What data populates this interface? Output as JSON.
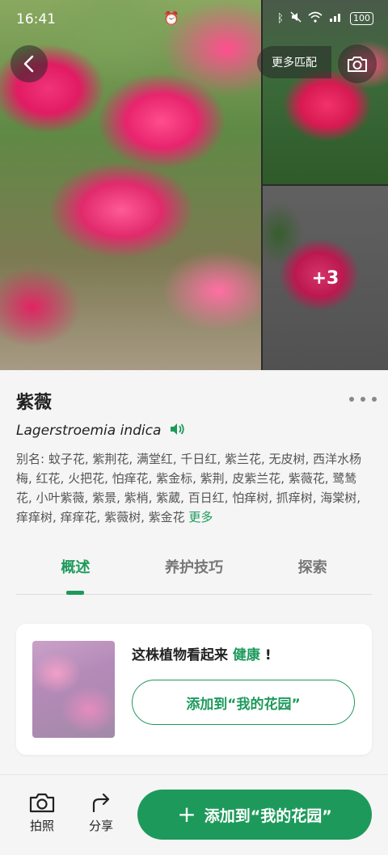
{
  "status": {
    "time": "16:41",
    "battery": "100",
    "icons": [
      "alarm-icon",
      "bluetooth-icon",
      "mute-icon",
      "wifi-icon",
      "signal-icon",
      "battery-icon"
    ]
  },
  "gallery": {
    "more_matches_label": "更多匹配",
    "extra_count": "+3"
  },
  "plant": {
    "name": "紫薇",
    "scientific_name": "Lagerstroemia indica",
    "aliases_text": "别名: 蚊子花, 紫荆花, 满堂红, 千日红, 紫兰花, 无皮树, 西洋水杨梅, 红花, 火把花, 怕痒花, 紫金标, 紫荆, 皮紫兰花, 紫薇花, 鹭鸶花, 小叶紫薇, 紫景, 紫梢, 紫葳, 百日红, 怕痒树, 抓痒树, 海棠树, 痒痒树, 痒痒花, 紫薇树, 紫金花",
    "more_label": "更多"
  },
  "tabs": [
    {
      "label": "概述",
      "active": true
    },
    {
      "label": "养护技巧",
      "active": false
    },
    {
      "label": "探索",
      "active": false
    }
  ],
  "health": {
    "title_prefix": "这株植物看起来",
    "status": "健康",
    "title_suffix": "!",
    "button_label": "添加到“我的花园”"
  },
  "bottom": {
    "photo_label": "拍照",
    "share_label": "分享",
    "add_label": "添加到“我的花园”"
  },
  "colors": {
    "accent": "#1d9a5b"
  }
}
